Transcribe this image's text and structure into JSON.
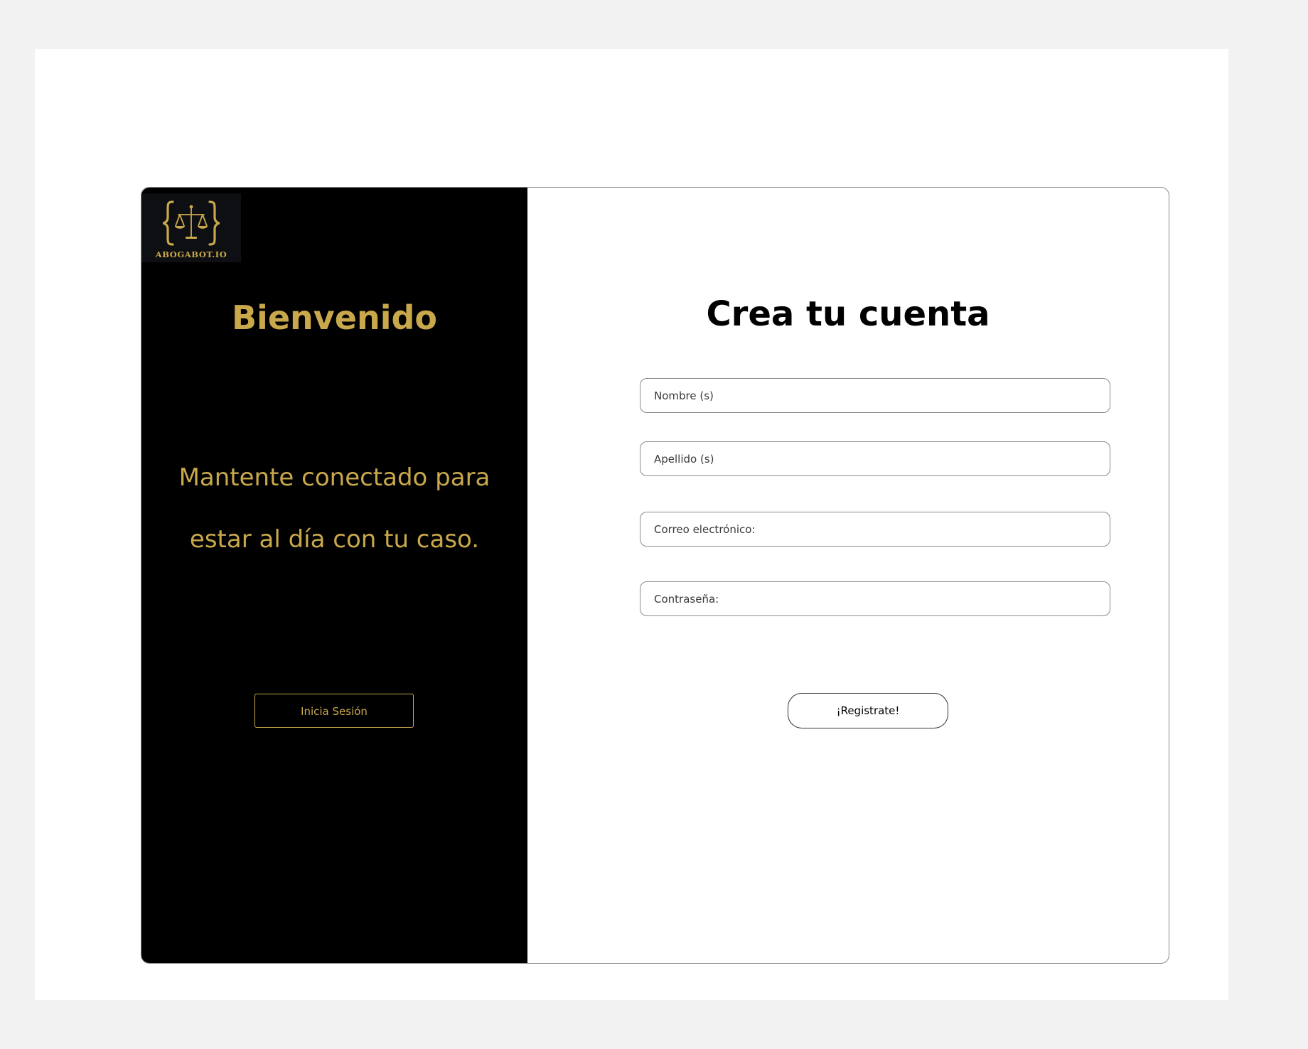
{
  "brand": {
    "logo_text": "ABOGABOT.IO",
    "accent_color": "#c9a84c"
  },
  "left_panel": {
    "welcome": "Bienvenido",
    "tagline_line1": "Mantente conectado para",
    "tagline_line2": "estar al día con tu caso.",
    "login_label": "Inicia Sesión"
  },
  "form": {
    "title": "Crea tu cuenta",
    "fields": [
      {
        "placeholder": "Nombre (s)"
      },
      {
        "placeholder": "Apellido (s)"
      },
      {
        "placeholder": "Correo electrónico:"
      },
      {
        "placeholder": "Contraseña:"
      }
    ],
    "submit_label": "¡Registrate!"
  },
  "icons": {
    "logo": "scales-of-justice-in-braces-icon"
  }
}
